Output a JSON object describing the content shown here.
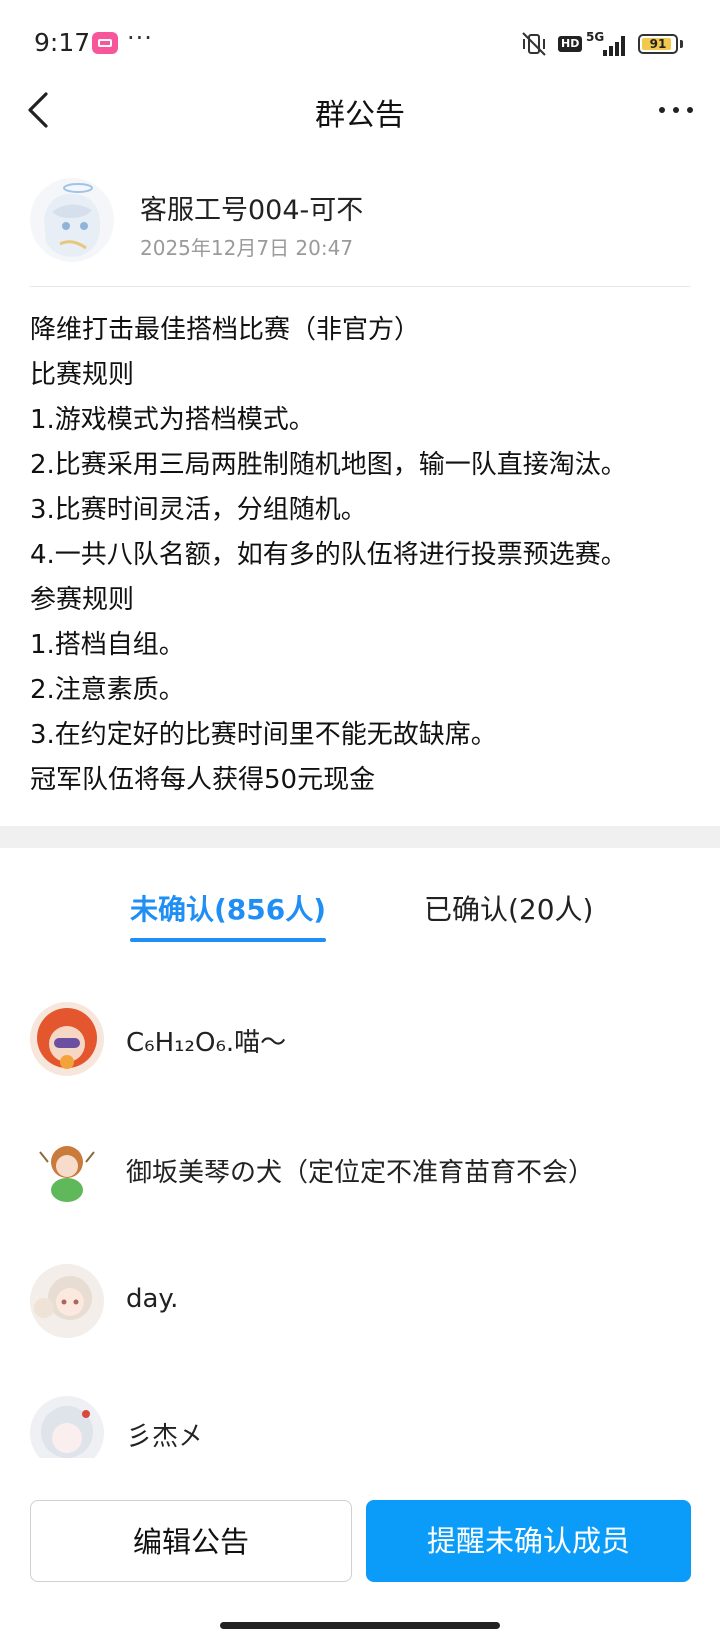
{
  "status_bar": {
    "time": "9:17",
    "more": "···",
    "hd": "HD",
    "network": "5G",
    "battery": "91",
    "battery_level": 0.91
  },
  "nav": {
    "title": "群公告"
  },
  "announcement": {
    "author_name": "客服工号004-可不",
    "timestamp": "2025年12月7日 20:47",
    "lines": [
      "降维打击最佳搭档比赛（非官方）",
      "比赛规则",
      "1.游戏模式为搭档模式。",
      "2.比赛采用三局两胜制随机地图，输一队直接淘汰。",
      "3.比赛时间灵活，分组随机。",
      "4.一共八队名额，如有多的队伍将进行投票预选赛。",
      "参赛规则",
      "1.搭档自组。",
      "2.注意素质。",
      "3.在约定好的比赛时间里不能无故缺席。",
      "冠军队伍将每人获得50元现金"
    ]
  },
  "tabs": {
    "unconfirmed": "未确认(856人)",
    "confirmed": "已确认(20人)"
  },
  "members": [
    {
      "name": "C₆H₁₂O₆.喵～"
    },
    {
      "name": "御坂美琴の犬（定位定不准育苗育不会）"
    },
    {
      "name": "day."
    },
    {
      "name": "彡杰㐅"
    }
  ],
  "buttons": {
    "edit": "编辑公告",
    "remind": "提醒未确认成员"
  },
  "colors": {
    "accent": "#1f8ef5",
    "primary_button": "#0a9cf8",
    "battery": "#f2c94c",
    "app_icon": "#f7579a"
  }
}
